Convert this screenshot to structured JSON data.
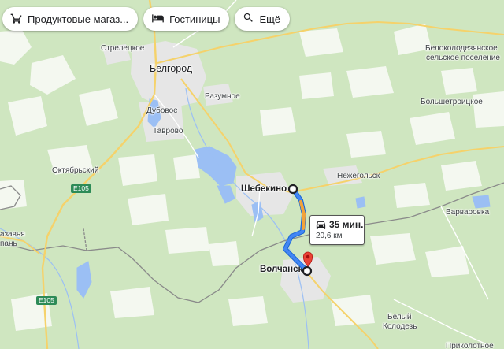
{
  "toolbar": {
    "chips": [
      {
        "label": "Продуктовые магаз...",
        "icon": "cart-icon"
      },
      {
        "label": "Гостиницы",
        "icon": "bed-icon"
      },
      {
        "label": "Ещё",
        "icon": "search-icon"
      }
    ]
  },
  "places": {
    "belgorod": "Белгород",
    "streletskoe": "Стрелецкое",
    "razumnoe": "Разумное",
    "dubovoe": "Дубовое",
    "tavrovo": "Таврово",
    "oktyabrsky": "Октябрьский",
    "shebekino": "Шебекино",
    "nezhegolsk": "Нежегольск",
    "varvarovka": "Варваровка",
    "volchansk": "Волчанск",
    "bely_kolodez_1": "Белый",
    "bely_kolodez_2": "Колодезь",
    "belokolodez_1": "Белоколодезянское",
    "belokolodez_2": "сельское поселение",
    "bolshetroitskoe": "Большетроицкое",
    "left_edge_1": "азавья",
    "left_edge_2": "пань",
    "bottom_right": "Приколотное"
  },
  "roads": {
    "e105_top": "E105",
    "e105_bottom": "E105"
  },
  "route": {
    "time": "35 мин.",
    "distance": "20,6 км",
    "start_icon": "origin-circle-icon",
    "end_icon": "destination-pin-icon"
  },
  "colors": {
    "land": "#cfe6c0",
    "field": "#ffffff",
    "water": "#9bbff4",
    "urban": "#e4e4e4",
    "route": "#4285f4",
    "traffic": "#f2a33a",
    "pin": "#ea4335",
    "highway": "#f5d26b",
    "border": "#8a8a8a"
  }
}
